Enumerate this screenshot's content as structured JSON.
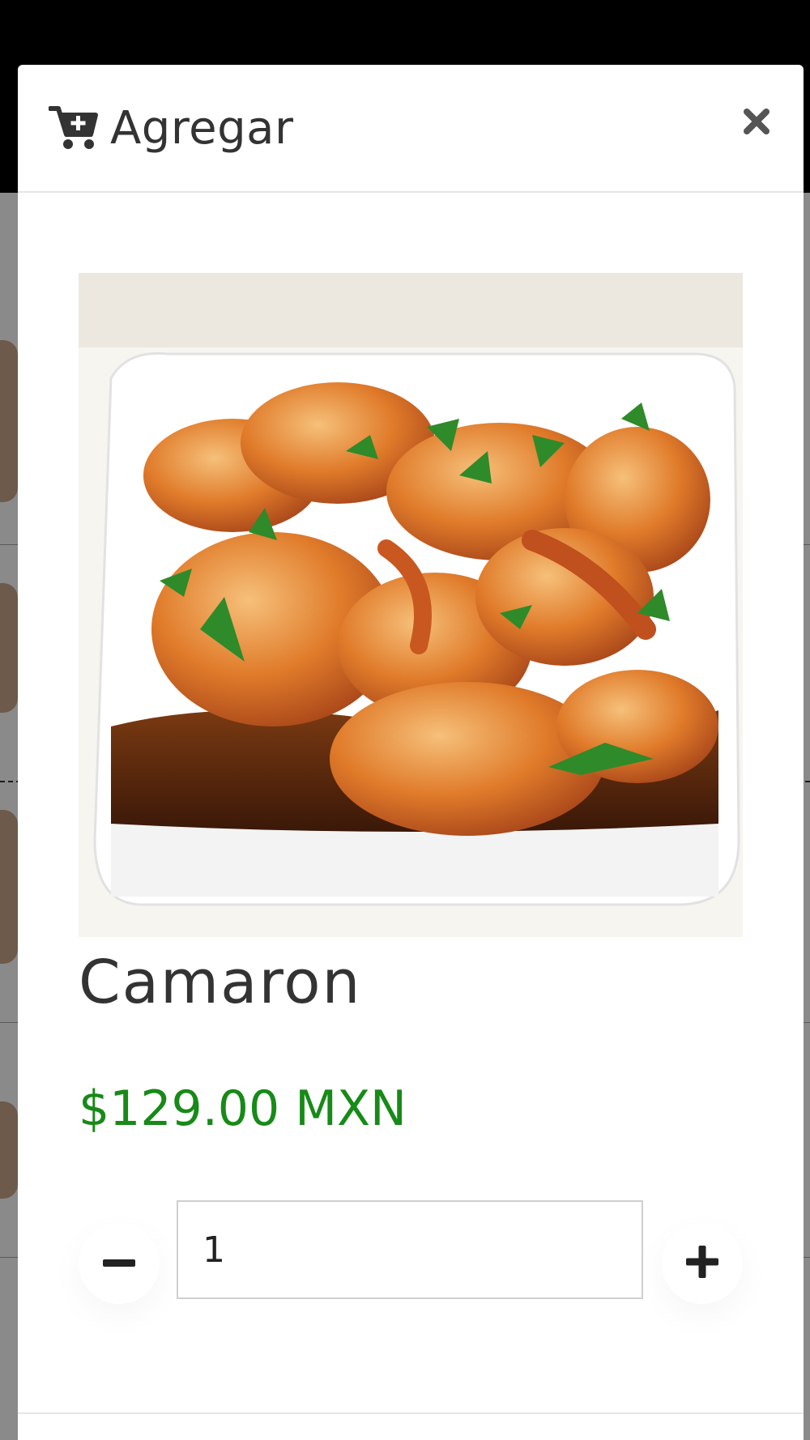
{
  "modal": {
    "title": "Agregar",
    "title_icon": "cart-plus-icon",
    "close_icon": "close-icon"
  },
  "product": {
    "name": "Camaron",
    "price": "$129.00 MXN",
    "image_alt": "shrimp-dish-photo"
  },
  "quantity": {
    "value": "1",
    "decrement_icon": "minus-icon",
    "increment_icon": "plus-icon"
  },
  "colors": {
    "price": "#178a17",
    "text": "#333333",
    "backdrop": "#000000"
  }
}
